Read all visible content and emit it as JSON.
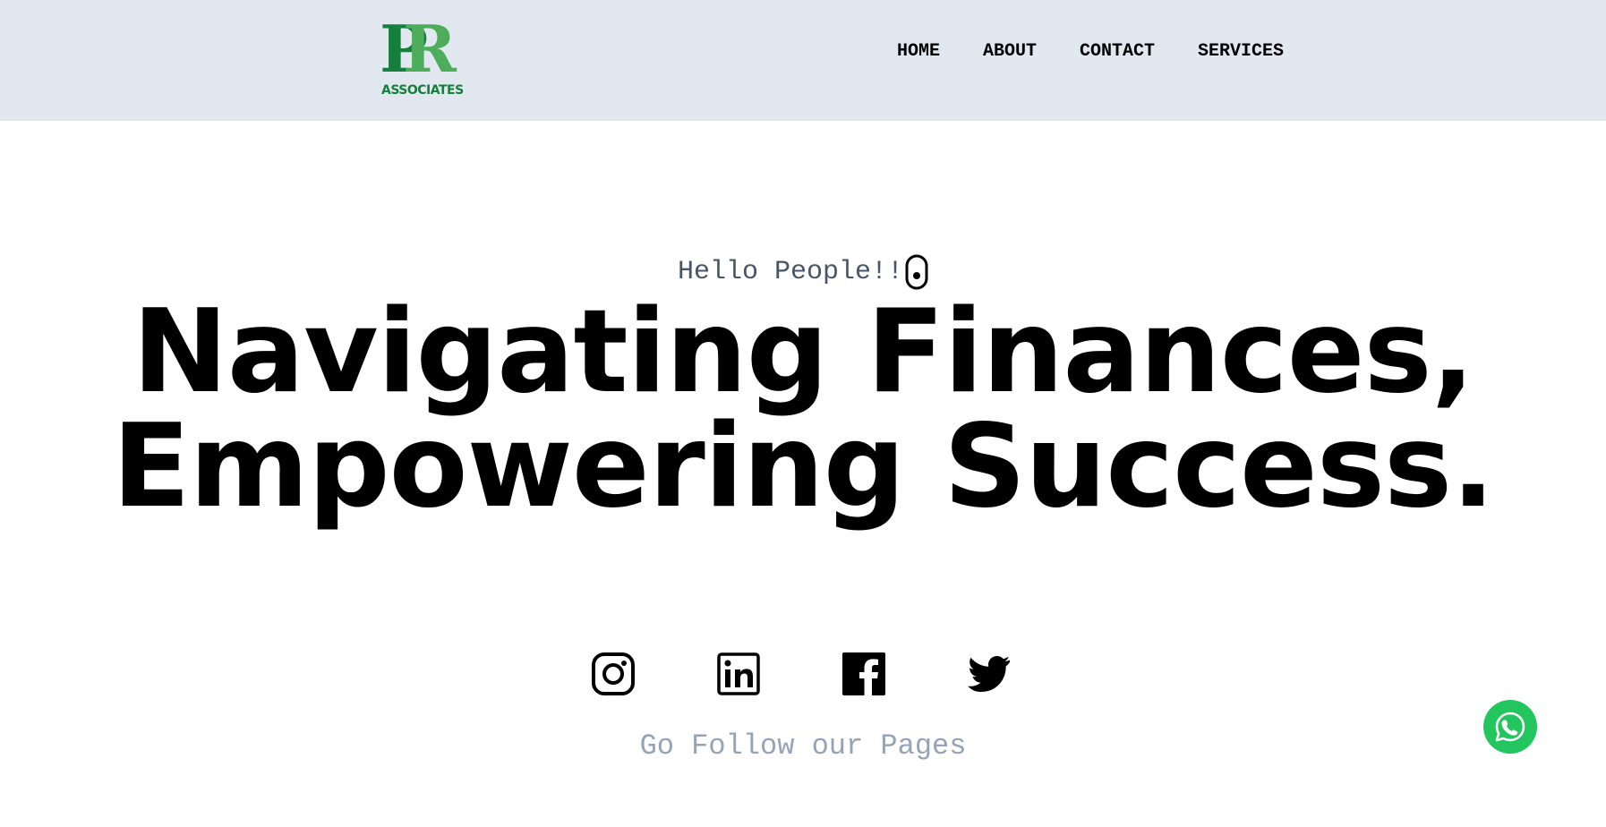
{
  "header": {
    "logo": {
      "letters": "PR",
      "subtitle": "ASSOCIATES"
    },
    "nav": [
      {
        "label": "HOME"
      },
      {
        "label": "ABOUT"
      },
      {
        "label": "CONTACT"
      },
      {
        "label": "SERVICES"
      }
    ]
  },
  "hero": {
    "greeting": "Hello People!!",
    "title_line1": "Navigating Finances,",
    "title_line2": "Empowering Success."
  },
  "social": {
    "icons": [
      "instagram-icon",
      "linkedin-icon",
      "facebook-icon",
      "twitter-icon"
    ],
    "follow_text": "Go Follow our Pages"
  },
  "whatsapp": {
    "icon": "whatsapp-icon",
    "color": "#22c55e"
  },
  "colors": {
    "header_bg": "#e2e8f0",
    "logo_dark": "#15803d",
    "logo_light": "#4ead5b",
    "greeting": "#475569",
    "follow": "#94a3b8"
  }
}
